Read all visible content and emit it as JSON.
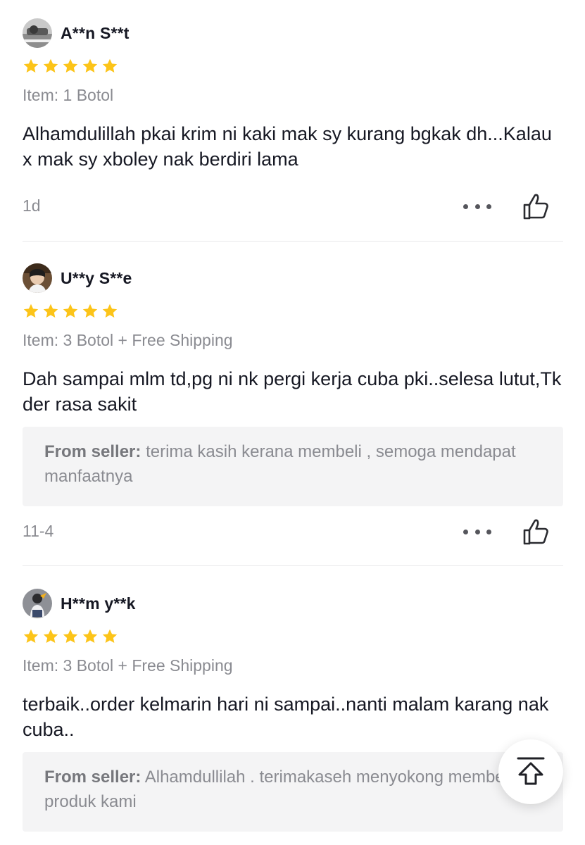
{
  "reviews": [
    {
      "username": "A**n S**t",
      "rating": 5,
      "item": "Item: 1 Botol",
      "comment": "Alhamdulillah pkai krim ni kaki mak sy kurang bgkak dh...Kalau x mak sy xboley nak berdiri lama",
      "date": "1d"
    },
    {
      "username": "U**y S**e",
      "rating": 5,
      "item": "Item: 3 Botol + Free Shipping",
      "comment": "Dah sampai mlm td,pg ni nk pergi kerja cuba pki..selesa lutut,Tk der rasa sakit",
      "seller_label": "From seller:",
      "seller_reply": "terima kasih kerana membeli , semoga mendapat manfaatnya",
      "date": "11-4"
    },
    {
      "username": "H**m y**k",
      "rating": 5,
      "item": "Item: 3 Botol + Free Shipping",
      "comment": "terbaik..order kelmarin hari ni sampai..nanti malam karang nak cuba..",
      "seller_label": "From seller:",
      "seller_reply": "Alhamdullilah . terimakaseh menyokong membeli produk kami"
    }
  ],
  "icons": {
    "star": "star-icon",
    "more": "more-horizontal-icon",
    "like": "thumbs-up-icon",
    "scroll_top": "arrow-up-to-top-icon"
  },
  "colors": {
    "star": "#fcc419",
    "muted_text": "#8a8b91",
    "seller_box_bg": "#f4f4f5"
  }
}
